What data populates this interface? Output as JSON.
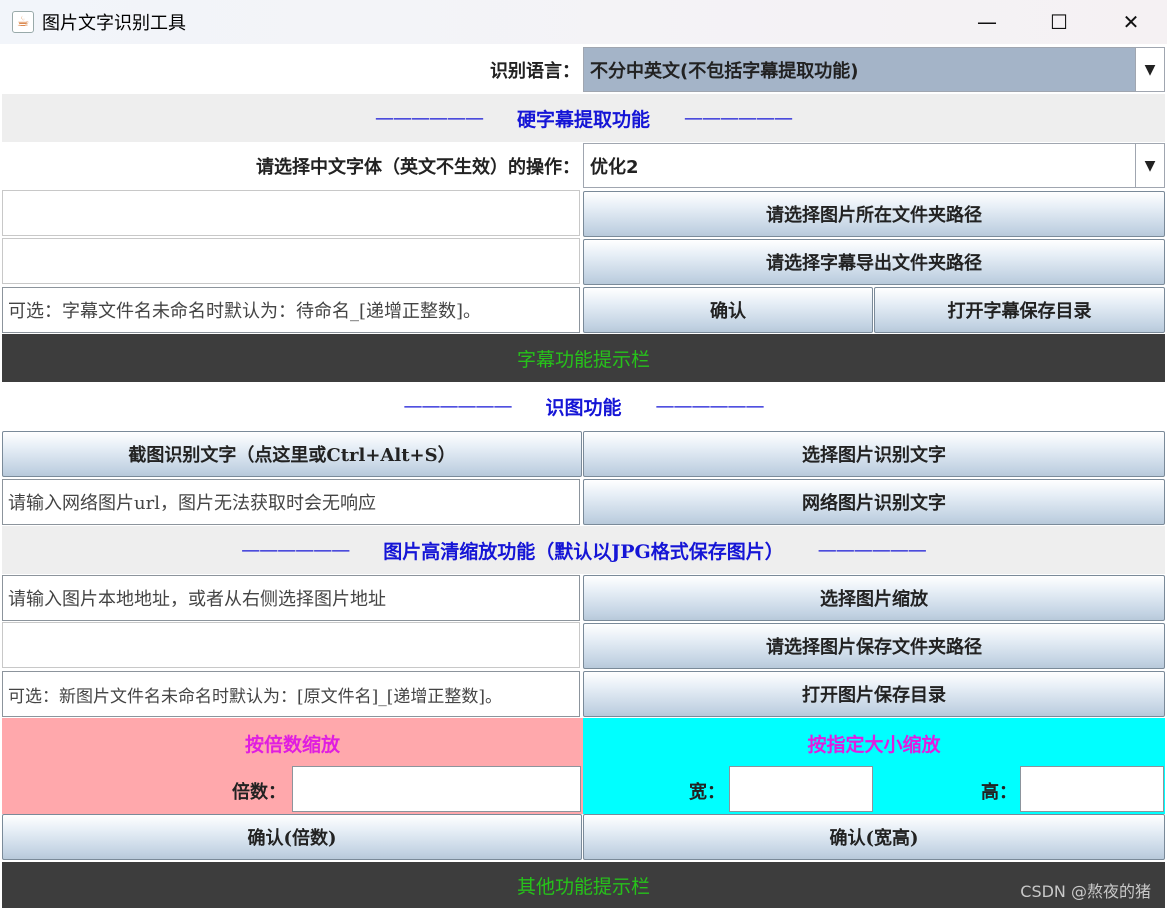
{
  "window": {
    "title": "图片文字识别工具",
    "controls": {
      "minimize": "—",
      "maximize": "☐",
      "close": "✕"
    }
  },
  "language": {
    "label": "识别语言：",
    "selected": "不分中英文(不包括字幕提取功能)"
  },
  "subtitle_section": {
    "title": "硬字幕提取功能",
    "dash": "——————",
    "font_op_label": "请选择中文字体（英文不生效）的操作：",
    "font_op_selected": "优化2",
    "choose_image_dir": "请选择图片所在文件夹路径",
    "choose_export_dir": "请选择字幕导出文件夹路径",
    "filename_placeholder": "可选：字幕文件名未命名时默认为：待命名_[递增正整数]。",
    "confirm": "确认",
    "open_save_dir": "打开字幕保存目录",
    "status": "字幕功能提示栏"
  },
  "ocr_section": {
    "title": "识图功能",
    "dash": "——————",
    "screenshot_btn": "截图识别文字（点这里或Ctrl+Alt+S）",
    "choose_image_btn": "选择图片识别文字",
    "url_placeholder": "请输入网络图片url，图片无法获取时会无响应",
    "net_image_btn": "网络图片识别文字"
  },
  "scale_section": {
    "title": "图片高清缩放功能（默认以JPG格式保存图片）",
    "dash": "——————",
    "local_path_placeholder": "请输入图片本地地址，或者从右侧选择图片地址",
    "choose_scale_btn": "选择图片缩放",
    "choose_save_dir_btn": "请选择图片保存文件夹路径",
    "new_name_placeholder": "可选：新图片文件名未命名时默认为：[原文件名]_[递增正整数]。",
    "open_save_dir_btn": "打开图片保存目录",
    "by_ratio_title": "按倍数缩放",
    "ratio_label": "倍数：",
    "by_size_title": "按指定大小缩放",
    "width_label": "宽：",
    "height_label": "高：",
    "confirm_ratio": "确认(倍数)",
    "confirm_size": "确认(宽高)",
    "status": "其他功能提示栏"
  },
  "watermark": "CSDN @熬夜的猪",
  "colors": {
    "section_title": "#1515d6",
    "status_bg": "#3d3d3d",
    "status_text": "#26c21a",
    "pink_panel": "#ffa8ac",
    "cyan_panel": "#00ffff",
    "magenta_text": "#e01ee0",
    "combo_highlight": "#a4b4c8"
  }
}
